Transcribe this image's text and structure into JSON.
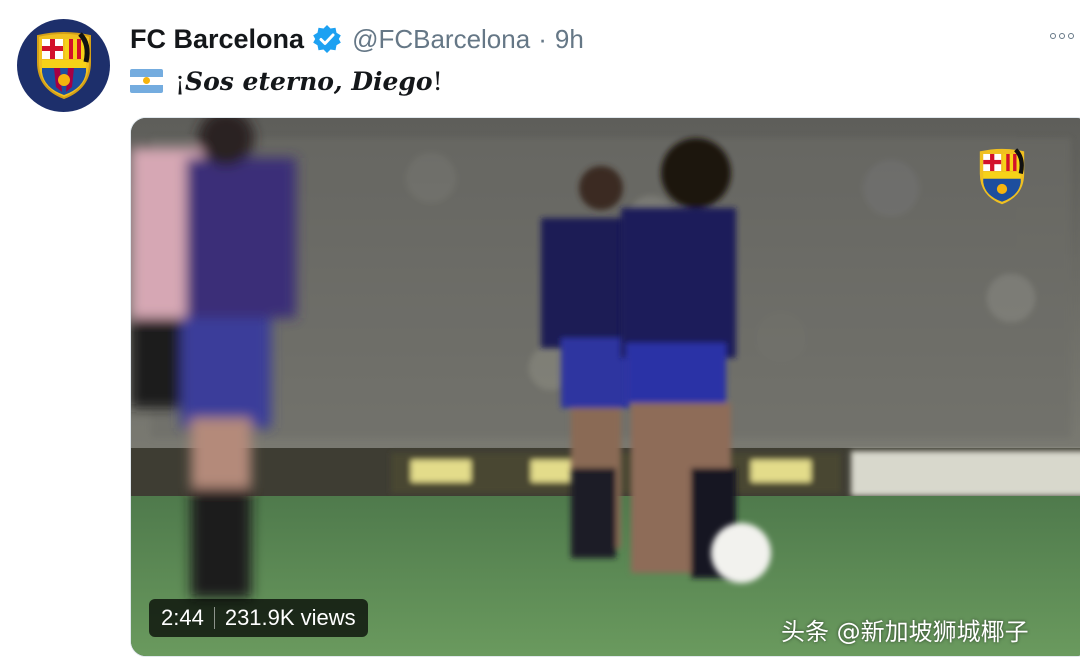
{
  "account": {
    "display_name": "FC Barcelona",
    "handle": "@FCBarcelona",
    "separator": "·",
    "time": "9h"
  },
  "tweet": {
    "prefix": "¡",
    "text": "Sos eterno, Diego",
    "suffix": "!",
    "flag_icon": "argentina-flag-icon"
  },
  "media": {
    "duration": "2:44",
    "views": "231.9K views",
    "watermark": "头条 @新加坡狮城椰子"
  },
  "colors": {
    "handle_gray": "#657786",
    "verified_blue": "#1da1f2",
    "avatar_bg": "#1d2f6b"
  }
}
